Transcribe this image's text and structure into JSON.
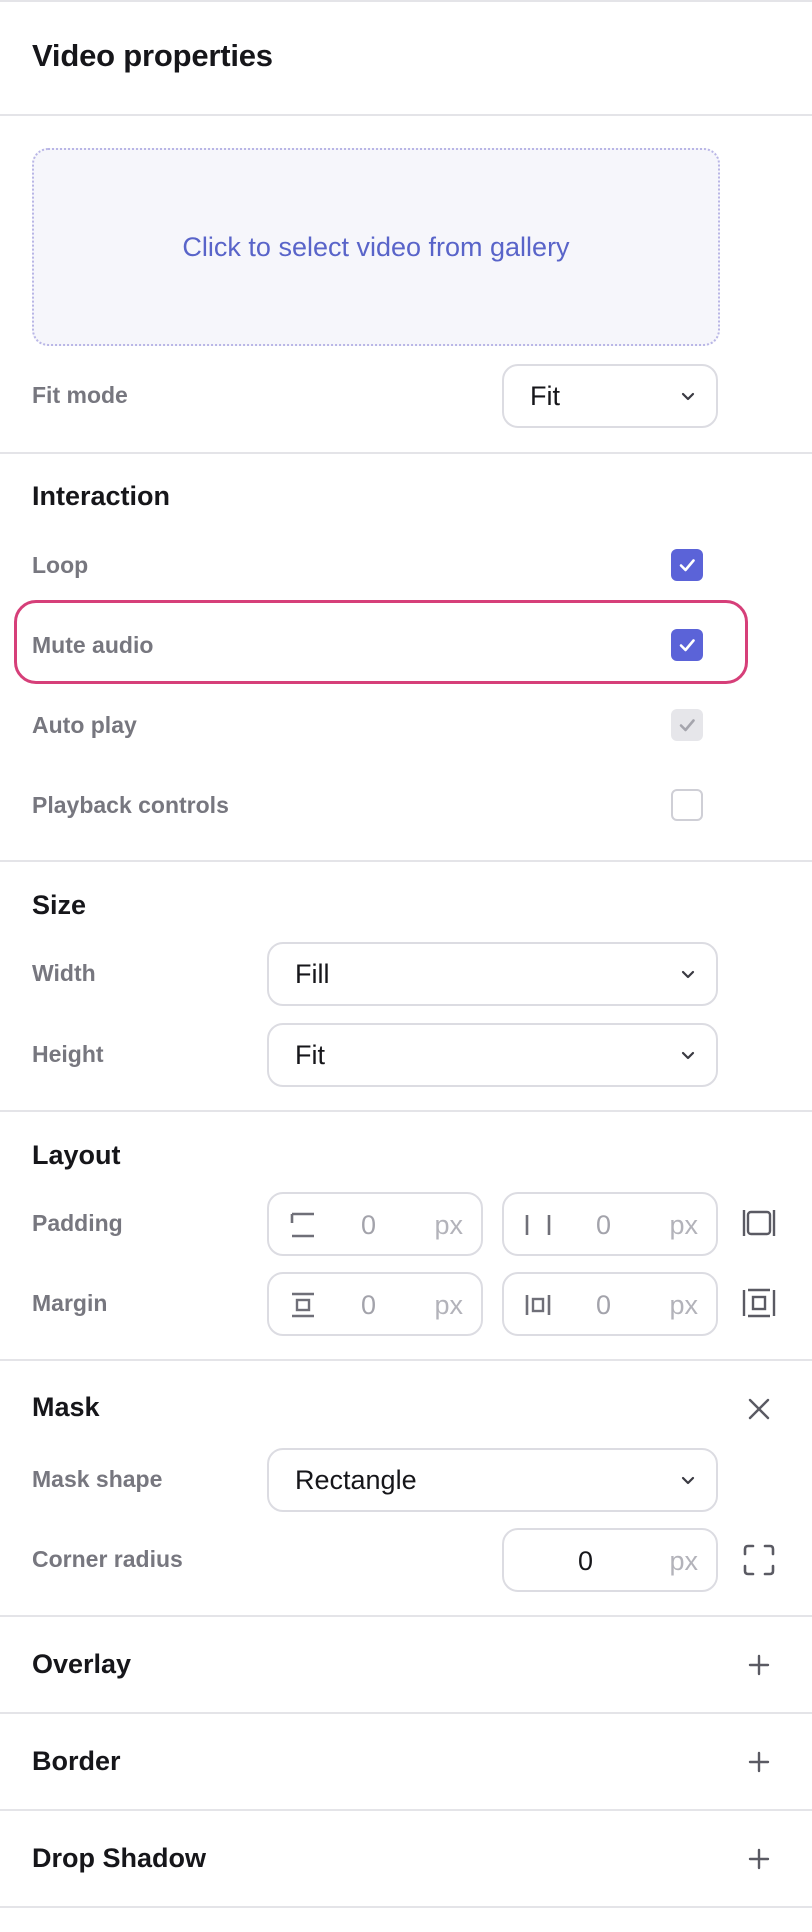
{
  "header": {
    "title": "Video properties"
  },
  "media": {
    "select_video_label": "Click to select video from gallery",
    "fit_mode_label": "Fit mode",
    "fit_mode_value": "Fit"
  },
  "interaction": {
    "title": "Interaction",
    "items": [
      {
        "label": "Loop",
        "state": "checked"
      },
      {
        "label": "Mute audio",
        "state": "checked"
      },
      {
        "label": "Auto play",
        "state": "checked-disabled"
      },
      {
        "label": "Playback controls",
        "state": "unchecked"
      }
    ]
  },
  "size": {
    "title": "Size",
    "width_label": "Width",
    "width_value": "Fill",
    "height_label": "Height",
    "height_value": "Fit"
  },
  "layout": {
    "title": "Layout",
    "padding_label": "Padding",
    "padding_vertical": "0",
    "padding_horizontal": "0",
    "margin_label": "Margin",
    "margin_vertical": "0",
    "margin_horizontal": "0",
    "unit": "px"
  },
  "mask": {
    "title": "Mask",
    "shape_label": "Mask shape",
    "shape_value": "Rectangle",
    "radius_label": "Corner radius",
    "radius_value": "0",
    "unit": "px"
  },
  "collapsed_sections": {
    "overlay": "Overlay",
    "border": "Border",
    "drop_shadow": "Drop Shadow"
  },
  "colors": {
    "accent": "#5b63d8",
    "highlight": "#d63f79",
    "link_text": "#5964c9"
  },
  "icons": {
    "chevron": "chevron-down-icon",
    "check": "check-icon",
    "close": "close-icon",
    "add": "plus-icon",
    "padding_link": "padding-link-icon",
    "margin_link": "margin-link-icon",
    "corner_radius": "corner-radius-icon"
  }
}
